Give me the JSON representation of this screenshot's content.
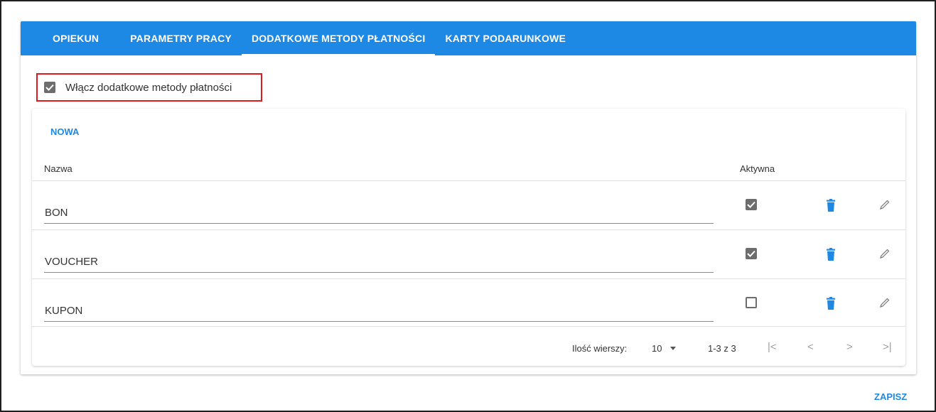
{
  "tabs": [
    {
      "label": "OPIEKUN"
    },
    {
      "label": "PARAMETRY PRACY"
    },
    {
      "label": "DODATKOWE METODY PŁATNOŚCI"
    },
    {
      "label": "KARTY PODARUNKOWE"
    }
  ],
  "active_tab": "DODATKOWE METODY PŁATNOŚCI",
  "enable_option": {
    "label": "Włącz dodatkowe metody płatności",
    "checked": true
  },
  "table": {
    "new_button": "NOWA",
    "columns": {
      "name": "Nazwa",
      "active": "Aktywna"
    },
    "rows": [
      {
        "name": "BON",
        "active": true
      },
      {
        "name": "VOUCHER",
        "active": true
      },
      {
        "name": "KUPON",
        "active": false
      }
    ],
    "pagination": {
      "rows_per_page_label": "Ilość wierszy:",
      "rows_per_page": "10",
      "range": "1-3 z 3"
    }
  },
  "save_button": "ZAPISZ",
  "colors": {
    "accent": "#1e88e5",
    "highlight_border": "#e0191f",
    "checkbox": "#6d6d6d"
  },
  "icons": {
    "delete": "trash-icon",
    "edit": "pencil-icon",
    "first": "first-page-icon",
    "prev": "chevron-left-icon",
    "next": "chevron-right-icon",
    "last": "last-page-icon"
  }
}
